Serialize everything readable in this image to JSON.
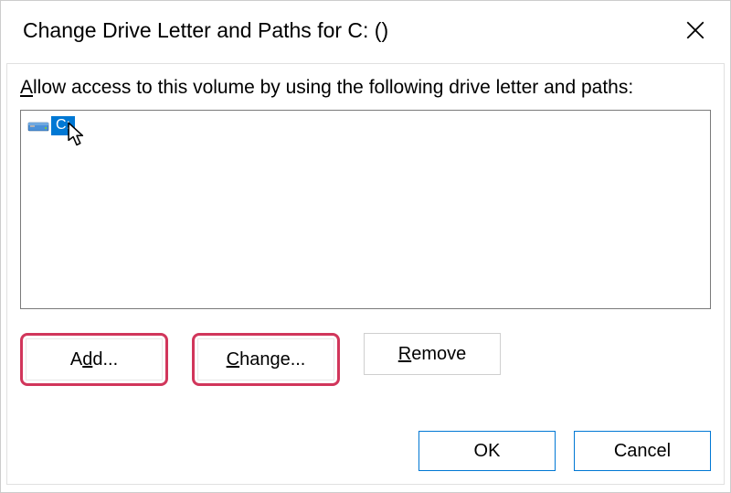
{
  "titlebar": {
    "title": "Change Drive Letter and Paths for C: ()"
  },
  "instruction": {
    "prefix_underlined": "A",
    "rest": "llow access to this volume by using the following drive letter and paths:"
  },
  "list": {
    "selected_drive_label": "C:"
  },
  "buttons": {
    "add": {
      "underlined": "d",
      "before": "A",
      "after": "d..."
    },
    "change": {
      "underlined": "C",
      "before": "",
      "after": "hange..."
    },
    "remove": {
      "underlined": "R",
      "before": "",
      "after": "emove"
    },
    "ok": "OK",
    "cancel": "Cancel"
  }
}
